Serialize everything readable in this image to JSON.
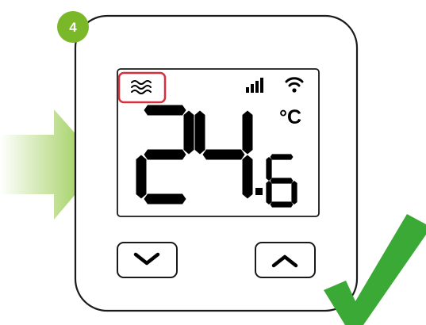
{
  "step": {
    "number": "4",
    "badge_color": "#7bb829"
  },
  "display": {
    "temperature": "24.6",
    "integer_digits": "24",
    "decimal_digit": "6",
    "unit": "°C",
    "signal_bars": 4,
    "wifi": true,
    "heating_icon": "heat-waves-icon",
    "highlight_color": "#d62f3d"
  },
  "buttons": {
    "down": "chevron-down-icon",
    "up": "chevron-up-icon"
  },
  "indicators": {
    "arrow": "arrow-right-icon",
    "arrow_color": "#8ec63f",
    "check": "checkmark-icon",
    "check_color": "#3aa935"
  }
}
